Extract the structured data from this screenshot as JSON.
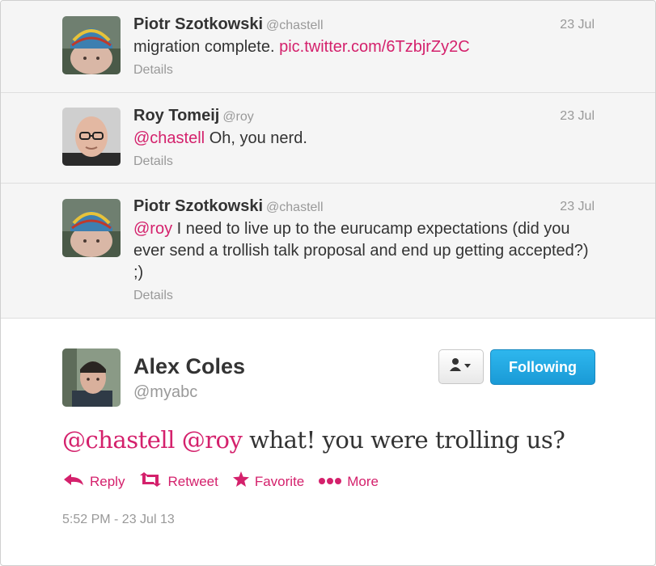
{
  "tweets": [
    {
      "name": "Piotr Szotkowski",
      "handle": "@chastell",
      "date": "23 Jul",
      "text": "migration complete.",
      "link": "pic.twitter.com/6TzbjrZy2C",
      "details": "Details"
    },
    {
      "name": "Roy Tomeij",
      "handle": "@roy",
      "date": "23 Jul",
      "mention": "@chastell",
      "text": "Oh, you nerd.",
      "details": "Details"
    },
    {
      "name": "Piotr Szotkowski",
      "handle": "@chastell",
      "date": "23 Jul",
      "mention": "@roy",
      "text": "I need to live up to the eurucamp expectations (did you ever send a trollish talk proposal and end up getting accepted?) ;)",
      "details": "Details"
    }
  ],
  "main_tweet": {
    "name": "Alex Coles",
    "handle": "@myabc",
    "mention1": "@chastell",
    "mention2": "@roy",
    "text": "what! you were trolling us?",
    "follow_label": "Following",
    "actions": {
      "reply": "Reply",
      "retweet": "Retweet",
      "favorite": "Favorite",
      "more": "More"
    },
    "timestamp": "5:52 PM - 23 Jul 13"
  },
  "colors": {
    "link": "#d4216c",
    "follow_button": "#1a9ad6",
    "muted": "#999999"
  },
  "icons": [
    "user-menu-icon",
    "reply-icon",
    "retweet-icon",
    "favorite-icon",
    "more-icon"
  ]
}
